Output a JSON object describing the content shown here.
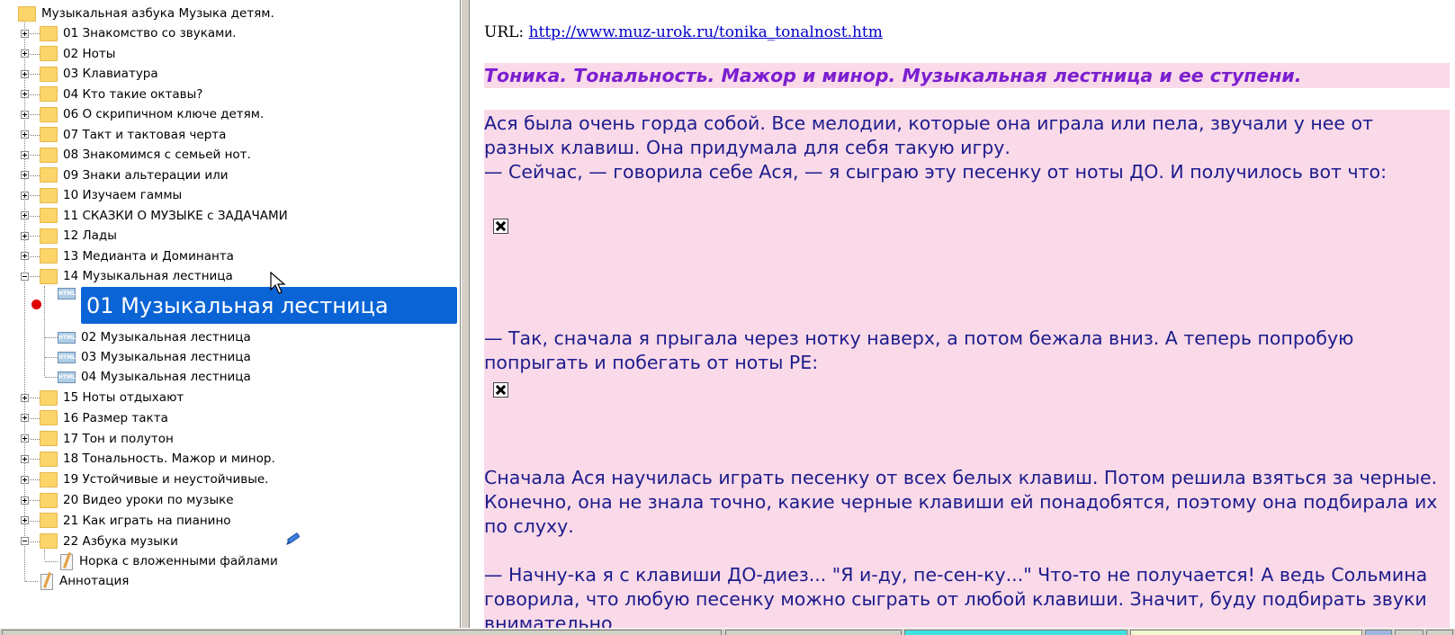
{
  "tree": {
    "root": "Музыкальная азбука Музыка детям.",
    "folders": [
      {
        "label": "01 Знакомство со звуками."
      },
      {
        "label": "02 Ноты"
      },
      {
        "label": "03 Клавиатура"
      },
      {
        "label": "04 Кто такие октавы?"
      },
      {
        "label": "06 О скрипичном ключе детям."
      },
      {
        "label": "07 Такт и тактовая черта"
      },
      {
        "label": "08 Знакомимся с семьей нот."
      },
      {
        "label": "09 Знаки альтерации или"
      },
      {
        "label": "10 Изучаем  гаммы"
      },
      {
        "label": "11 СКАЗКИ О МУЗЫКЕ с  ЗАДАЧАМИ"
      },
      {
        "label": "12 Лады"
      },
      {
        "label": "13 Медианта и Доминанта"
      },
      {
        "label": "14 Музыкальная лестница"
      }
    ],
    "children_14": [
      {
        "label": "01 Музыкальная лестница"
      },
      {
        "label": "02 Музыкальная лестница"
      },
      {
        "label": "03 Музыкальная лестница"
      },
      {
        "label": "04 Музыкальная лестница"
      }
    ],
    "folders_after": [
      {
        "label": "15 Ноты отдыхают"
      },
      {
        "label": "16 Размер такта"
      },
      {
        "label": "17 Тон и  полутон"
      },
      {
        "label": "18 Тональность. Мажор и минор."
      },
      {
        "label": "19 Устойчивые и неустойчивые."
      },
      {
        "label": "20 Видео уроки по музыке"
      },
      {
        "label": "21 Как играть  на пианино"
      },
      {
        "label": "22 Азбука музыки"
      }
    ],
    "child_22": "Норка с вложенными файлами",
    "annotation": "Аннотация"
  },
  "content": {
    "url_label": "URL:",
    "url": "http://www.muz-urok.ru/tonika_tonalnost.htm",
    "title": "Тоника. Тональность. Мажор и минор. Музыкальная лестница и ее ступени.",
    "p1": "Ася была очень горда собой. Все мелодии, которые она играла или пела, звучали у нее от разных клавиш. Она придумала для себя такую игру.",
    "p2": "— Сейчас, — говорила себе Ася, — я сыграю эту песенку от ноты ДО. И получилось вот что:",
    "p3": "— Так, сначала я прыгала через нотку наверх, а потом бежала вниз. А теперь попробую попрыгать и побегать от ноты РЕ:",
    "p4": "Сначала Ася научилась играть песенку от всех белых клавиш. Потом решила взяться за черные. Конечно, она не знала точно, какие черные клавиши ей понадобятся, поэтому она подбирала их по слуху.",
    "p5": "— Начну-ка я с клавиши ДО-диез... \"Я и-ду, пе-сен-ку...\" Что-то не получается! А ведь Сольмина говорила, что любую песенку можно сыграть от любой клавиши. Значит, буду подбирать звуки внимательно"
  },
  "colors": {
    "selection": "#0a64d6",
    "title_color": "#7b1fd0",
    "body_text": "#1c1c8c",
    "pink_bg": "#fad9e8",
    "folder": "#fcd56a"
  }
}
